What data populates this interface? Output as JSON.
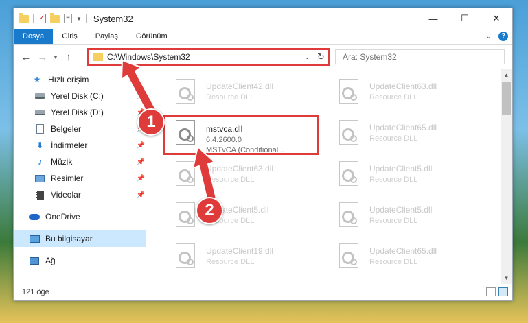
{
  "window": {
    "title": "System32",
    "controls": {
      "minimize": "—",
      "maximize": "☐",
      "close": "✕"
    }
  },
  "ribbon": {
    "tabs": [
      "Dosya",
      "Giriş",
      "Paylaş",
      "Görünüm"
    ],
    "active_tab": "Dosya"
  },
  "address": {
    "path": "C:\\Windows\\System32",
    "search_placeholder": "Ara: System32"
  },
  "sidebar": {
    "items": [
      {
        "label": "Hızlı erişim",
        "icon": "star-icon",
        "pinned": false
      },
      {
        "label": "Yerel Disk (C:)",
        "icon": "drive-icon",
        "pinned": true
      },
      {
        "label": "Yerel Disk (D:)",
        "icon": "drive-icon",
        "pinned": true
      },
      {
        "label": "Belgeler",
        "icon": "document-icon",
        "pinned": true
      },
      {
        "label": "İndirmeler",
        "icon": "download-icon",
        "pinned": true
      },
      {
        "label": "Müzik",
        "icon": "music-icon",
        "pinned": true
      },
      {
        "label": "Resimler",
        "icon": "pictures-icon",
        "pinned": true
      },
      {
        "label": "Videolar",
        "icon": "videos-icon",
        "pinned": true
      },
      {
        "label": "OneDrive",
        "icon": "onedrive-icon",
        "pinned": false
      },
      {
        "label": "Bu bilgisayar",
        "icon": "this-pc-icon",
        "pinned": false,
        "selected": true
      },
      {
        "label": "Ağ",
        "icon": "network-icon",
        "pinned": false
      }
    ]
  },
  "files": [
    {
      "name": "UpdateClient42.dll",
      "sub": "Resource DLL"
    },
    {
      "name": "UpdateClient63.dll",
      "sub": "Resource DLL"
    },
    {
      "name": "mstvca.dll",
      "version": "6.4.2600.0",
      "desc": "MSTvCA (Conditional..."
    },
    {
      "name": "UpdateClient65.dll",
      "sub": "Resource DLL"
    },
    {
      "name": "UpdateClient63.dll",
      "sub": "Resource DLL"
    },
    {
      "name": "UpdateClient5.dll",
      "sub": "Resource DLL"
    },
    {
      "name": "UpdateClient5.dll",
      "sub": "Resource DLL"
    },
    {
      "name": "UpdateClient5.dll",
      "sub": "Resource DLL"
    },
    {
      "name": "UpdateClient19.dll",
      "sub": "Resource DLL"
    },
    {
      "name": "UpdateClient65.dll",
      "sub": "Resource DLL"
    }
  ],
  "status": {
    "count": "121 öğe"
  },
  "annotations": {
    "step1": "1",
    "step2": "2",
    "color": "#e03b3b"
  }
}
